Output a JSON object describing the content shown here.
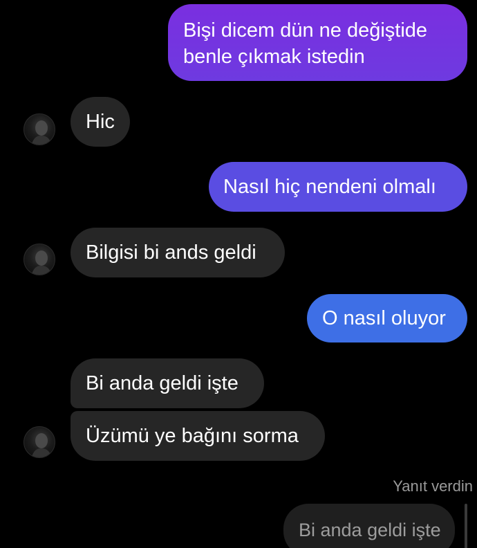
{
  "messages": [
    {
      "id": "m1",
      "direction": "sent",
      "lines": [
        "Bişi dicem dün ne değiştide",
        "benle çıkmak istedin"
      ],
      "color": "#7433e0"
    },
    {
      "id": "m2",
      "direction": "received",
      "text": "Hic"
    },
    {
      "id": "m3",
      "direction": "sent",
      "text": "Nasıl hiç nendeni olmalı",
      "color": "#5a4ee2"
    },
    {
      "id": "m4",
      "direction": "received",
      "text": "Bilgisi bi ands geldi"
    },
    {
      "id": "m5",
      "direction": "sent",
      "text": "O nasıl oluyor",
      "color": "#3f6fe6"
    },
    {
      "id": "m6",
      "direction": "received",
      "text": "Bi anda geldi işte"
    },
    {
      "id": "m7",
      "direction": "received",
      "text": "Üzümü ye bağını sorma"
    }
  ],
  "reply": {
    "label": "Yanıt verdin",
    "quoted_text": "Bi anda geldi işte"
  },
  "colors": {
    "background": "#000000",
    "received_bubble": "#262626",
    "sent_gradient_top": "#7c2fe0",
    "sent_gradient_bottom": "#3b74e8"
  }
}
